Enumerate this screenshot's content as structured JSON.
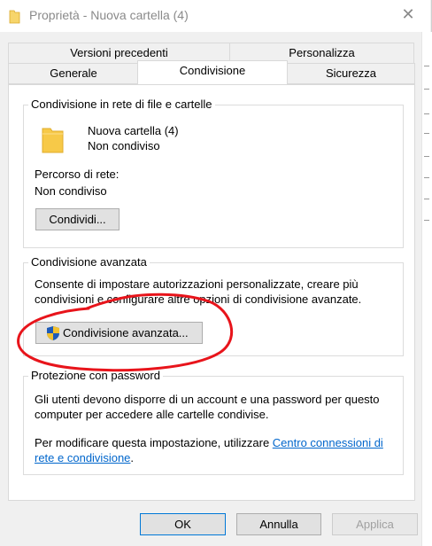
{
  "window": {
    "title": "Proprietà - Nuova cartella (4)",
    "close_symbol": "✕"
  },
  "tabs": {
    "row1": [
      "Versioni precedenti",
      "Personalizza"
    ],
    "row2": [
      "Generale",
      "Condivisione",
      "Sicurezza"
    ],
    "active": "Condivisione"
  },
  "network_sharing": {
    "group_label": "Condivisione in rete di file e cartelle",
    "folder_name": "Nuova cartella (4)",
    "folder_status": "Non condiviso",
    "path_label": "Percorso di rete:",
    "path_value": "Non condiviso",
    "share_button": "Condividi..."
  },
  "advanced_sharing": {
    "group_label": "Condivisione avanzata",
    "description_line1": "Consente di impostare autorizzazioni personalizzate, creare più",
    "description_line2": "condivisioni e configurare altre opzioni di condivisione avanzate.",
    "button": "Condivisione avanzata..."
  },
  "password_protection": {
    "group_label": "Protezione con password",
    "line1": "Gli utenti devono disporre di un account e una password per questo",
    "line2": "computer per accedere alle cartelle condivise.",
    "line3_prefix": "Per modificare questa impostazione, utilizzare ",
    "link_part1": "Centro connessioni di",
    "link_part2": "rete e condivisione",
    "line4_suffix": "."
  },
  "footer": {
    "ok": "OK",
    "cancel": "Annulla",
    "apply": "Applica"
  },
  "colors": {
    "link": "#0066cc",
    "annotation_circle": "#e8141b",
    "folder_yellow": "#f7c948",
    "shield_blue": "#1e5bb8",
    "shield_yellow": "#f2c12e"
  }
}
